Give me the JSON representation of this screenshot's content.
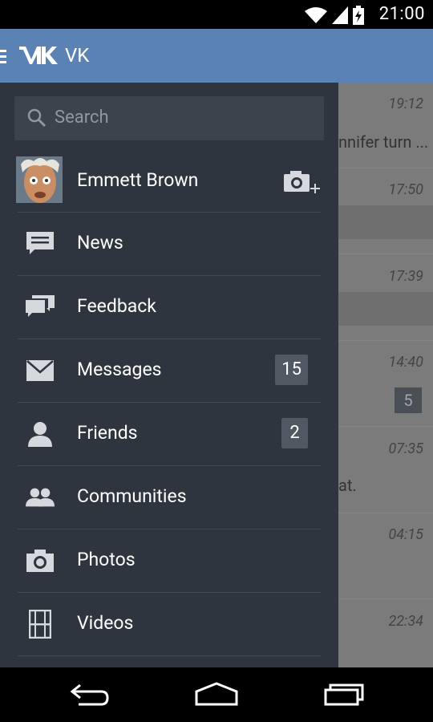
{
  "status_bar": {
    "time": "21:00"
  },
  "app_bar": {
    "title": "VK",
    "logo": "VK"
  },
  "drawer": {
    "search": {
      "placeholder": "Search"
    },
    "profile": {
      "name": "Emmett Brown"
    },
    "items": [
      {
        "label": "News",
        "icon": "news-icon"
      },
      {
        "label": "Feedback",
        "icon": "feedback-icon"
      },
      {
        "label": "Messages",
        "icon": "messages-icon",
        "badge": "15"
      },
      {
        "label": "Friends",
        "icon": "friends-icon",
        "badge": "2"
      },
      {
        "label": "Communities",
        "icon": "communities-icon"
      },
      {
        "label": "Photos",
        "icon": "photos-icon"
      },
      {
        "label": "Videos",
        "icon": "videos-icon"
      }
    ]
  },
  "background_list": {
    "rows": [
      {
        "time": "19:12",
        "snippet": "nnifer turn ..."
      },
      {
        "time": "17:50"
      },
      {
        "time": "17:39"
      },
      {
        "time": "14:40",
        "unread": "5"
      },
      {
        "time": "07:35",
        "snippet": "at."
      },
      {
        "time": "04:15"
      },
      {
        "time": "22:34"
      }
    ]
  },
  "colors": {
    "app_bar": "#5b82b5",
    "drawer": "#2f353f",
    "badge": "#505863"
  }
}
